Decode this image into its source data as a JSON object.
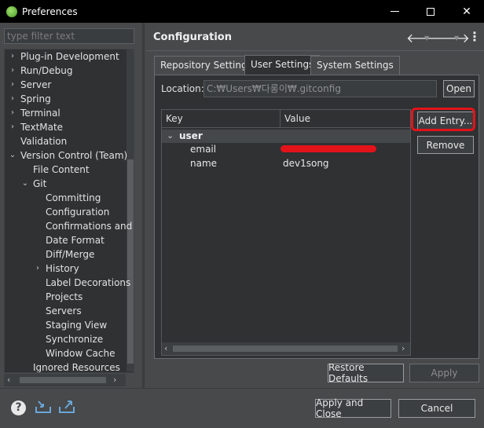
{
  "window": {
    "title": "Preferences"
  },
  "filter": {
    "placeholder": "type filter text"
  },
  "tree": [
    {
      "label": "Plug-in Development",
      "twisty": "right",
      "level": 0
    },
    {
      "label": "Run/Debug",
      "twisty": "right",
      "level": 0
    },
    {
      "label": "Server",
      "twisty": "right",
      "level": 0
    },
    {
      "label": "Spring",
      "twisty": "right",
      "level": 0
    },
    {
      "label": "Terminal",
      "twisty": "right",
      "level": 0
    },
    {
      "label": "TextMate",
      "twisty": "right",
      "level": 0
    },
    {
      "label": "Validation",
      "twisty": "none",
      "level": 0
    },
    {
      "label": "Version Control (Team)",
      "twisty": "down",
      "level": 0
    },
    {
      "label": "File Content",
      "twisty": "none",
      "level": 1
    },
    {
      "label": "Git",
      "twisty": "down",
      "level": 1
    },
    {
      "label": "Committing",
      "twisty": "none",
      "level": 2
    },
    {
      "label": "Configuration",
      "twisty": "none",
      "level": 2
    },
    {
      "label": "Confirmations and",
      "twisty": "none",
      "level": 2
    },
    {
      "label": "Date Format",
      "twisty": "none",
      "level": 2
    },
    {
      "label": "Diff/Merge",
      "twisty": "none",
      "level": 2
    },
    {
      "label": "History",
      "twisty": "right",
      "level": 2
    },
    {
      "label": "Label Decorations",
      "twisty": "none",
      "level": 2
    },
    {
      "label": "Projects",
      "twisty": "none",
      "level": 2
    },
    {
      "label": "Servers",
      "twisty": "none",
      "level": 2
    },
    {
      "label": "Staging View",
      "twisty": "none",
      "level": 2
    },
    {
      "label": "Synchronize",
      "twisty": "none",
      "level": 2
    },
    {
      "label": "Window Cache",
      "twisty": "none",
      "level": 2
    },
    {
      "label": "Ignored Resources",
      "twisty": "none",
      "level": 1
    }
  ],
  "page": {
    "title": "Configuration"
  },
  "tabs": [
    "Repository Settings",
    "User Settings",
    "System Settings"
  ],
  "location": {
    "label": "Location:",
    "value": "C:₩Users₩다롱이₩.gitconfig",
    "open_label": "Open"
  },
  "table": {
    "columns": [
      "Key",
      "Value"
    ],
    "group": "user",
    "rows": [
      {
        "key": "email",
        "value": ""
      },
      {
        "key": "name",
        "value": "dev1song"
      }
    ]
  },
  "buttons": {
    "add_entry": "Add Entry...",
    "remove": "Remove",
    "restore_defaults": "Restore Defaults",
    "apply": "Apply",
    "apply_close": "Apply and Close",
    "cancel": "Cancel"
  },
  "colors": {
    "highlight": "#e3131a",
    "background": "#47494b",
    "panel": "#2f3133"
  }
}
